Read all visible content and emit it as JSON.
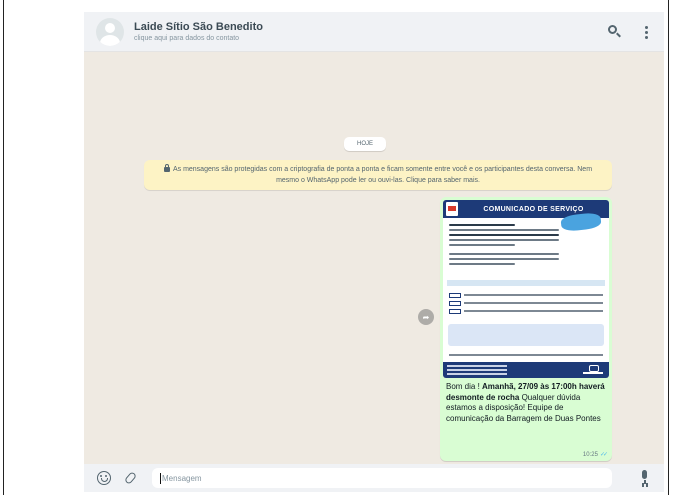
{
  "header": {
    "contact_name": "Laide Sítio São Benedito",
    "contact_subtitle": "clique aqui para dados do contato",
    "search_icon": "search-icon",
    "menu_icon": "menu-dots-icon"
  },
  "chat": {
    "date_chip": "HOJE",
    "e2e_notice": "As mensagens são protegidas com a criptografia de ponta a ponta e ficam somente entre você e os participantes desta conversa. Nem mesmo o WhatsApp pode ler ou ouvi-las. Clique para saber mais.",
    "message": {
      "image_title": "COMUNICADO DE SERVIÇO",
      "text_prefix": "Bom dia ! ",
      "text_bold": "Amanhã, 27/09 às 17:00h haverá desmonte de rocha",
      "text_suffix": " Qualquer dúvida estamos a disposição! Equipe de comunicação da Barragem de Duas Pontes",
      "time": "10:25",
      "status": "read"
    }
  },
  "footer": {
    "input_placeholder": "Mensagem",
    "emoji_icon": "emoji-icon",
    "attach_icon": "attach-icon",
    "mic_icon": "mic-icon"
  },
  "colors": {
    "chat_background": "#efeae2",
    "outgoing_bubble": "#d9fdd3",
    "notice_background": "#fdf3c5",
    "poster_blue": "#1d3a78"
  }
}
